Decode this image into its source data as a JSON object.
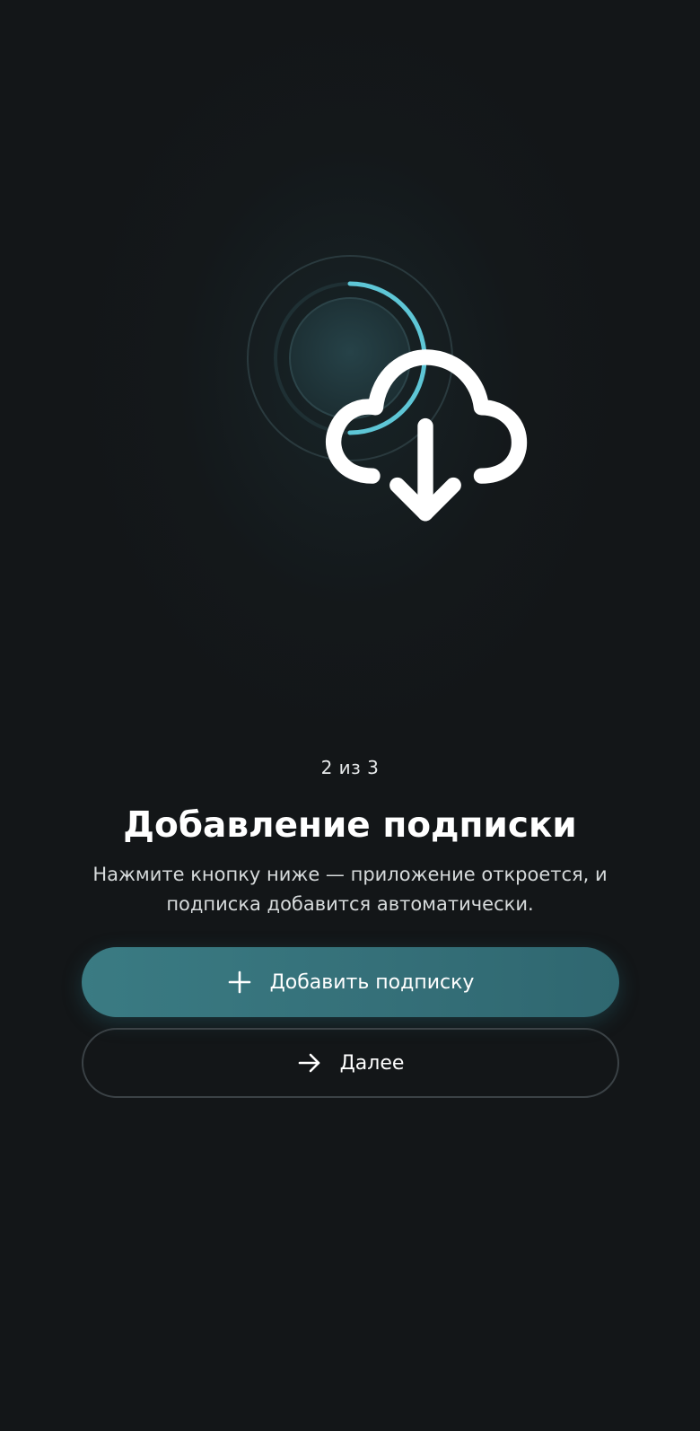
{
  "onboarding": {
    "step_counter": "2 из 3",
    "title": "Добавление подписки",
    "subtitle_line1": "Нажмите кнопку ниже — приложение откроется, и",
    "subtitle_line2": "подписка добавится автоматически.",
    "progress_fraction": 0.5,
    "hero_icon": "cloud-download-icon"
  },
  "actions": {
    "primary_label": "Добавить подписку",
    "primary_icon": "plus-icon",
    "secondary_label": "Далее",
    "secondary_icon": "arrow-right-icon"
  },
  "colors": {
    "background": "#131618",
    "accent": "#3a7b83",
    "progress_ring": "#5ec6d6",
    "text_primary": "#ffffff",
    "text_secondary": "#d7dbdc",
    "outline": "#3b4246"
  }
}
